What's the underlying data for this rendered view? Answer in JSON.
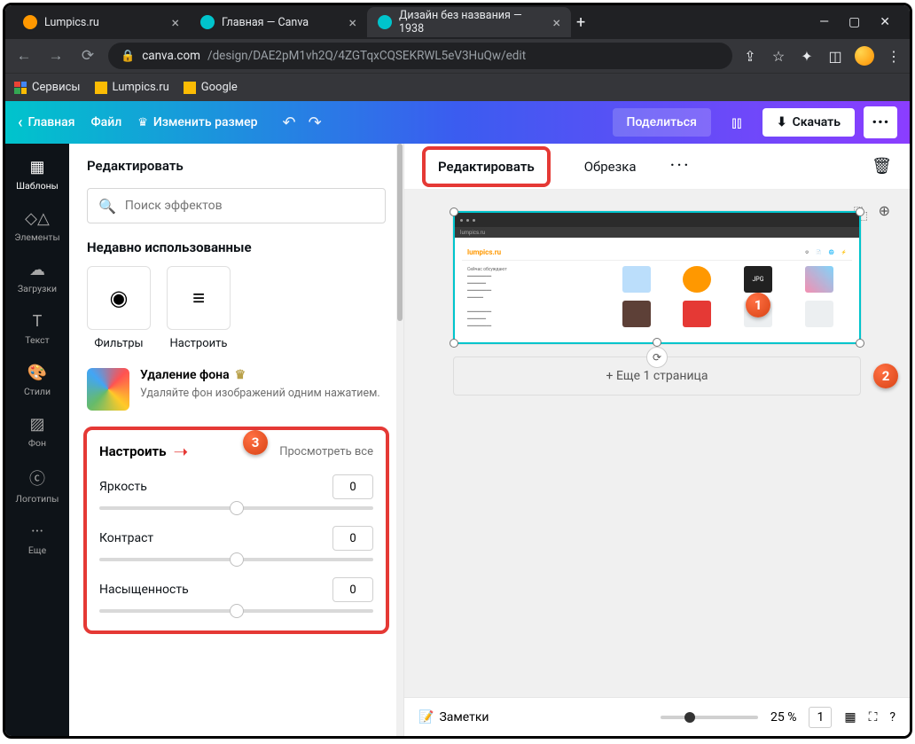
{
  "browser": {
    "tabs": [
      {
        "title": "Lumpics.ru",
        "icon": "#ff9800"
      },
      {
        "title": "Главная — Canva",
        "icon": "#00c4cc"
      },
      {
        "title": "Дизайн без названия — 1938",
        "icon": "#00c4cc",
        "active": true
      }
    ],
    "url_host": "canva.com",
    "url_path": "/design/DAE2pM1vh2Q/4ZGTqxCQSEKRWL5eV3HuQw/edit",
    "bookmarks": {
      "services": "Сервисы",
      "lumpics": "Lumpics.ru",
      "google": "Google"
    }
  },
  "canva_top": {
    "home": "Главная",
    "file": "Файл",
    "resize": "Изменить размер",
    "share": "Поделиться",
    "download": "Скачать"
  },
  "rail": {
    "templates": "Шаблоны",
    "elements": "Элементы",
    "uploads": "Загрузки",
    "text": "Текст",
    "styles": "Стили",
    "background": "Фон",
    "logos": "Логотипы",
    "more": "Еще"
  },
  "panel": {
    "title": "Редактировать",
    "search_placeholder": "Поиск эффектов",
    "recent_title": "Недавно использованные",
    "filters": "Фильтры",
    "adjust": "Настроить",
    "bg_remove_title": "Удаление фона",
    "bg_remove_desc": "Удаляйте фон изображений одним нажатием.",
    "adjust_title": "Настроить",
    "view_all": "Просмотреть все",
    "sliders": {
      "brightness": {
        "label": "Яркость",
        "value": "0"
      },
      "contrast": {
        "label": "Контраст",
        "value": "0"
      },
      "saturation": {
        "label": "Насыщенность",
        "value": "0"
      }
    }
  },
  "canvas_toolbar": {
    "edit": "Редактировать",
    "crop": "Обрезка"
  },
  "add_page": "+ Еще 1 страница",
  "mini": {
    "logo": "lumpics.ru",
    "url": "lumpics.ru"
  },
  "bottom": {
    "notes": "Заметки",
    "zoom": "25 %",
    "page": "1"
  },
  "badges": {
    "b1": "1",
    "b2": "2",
    "b3": "3"
  }
}
